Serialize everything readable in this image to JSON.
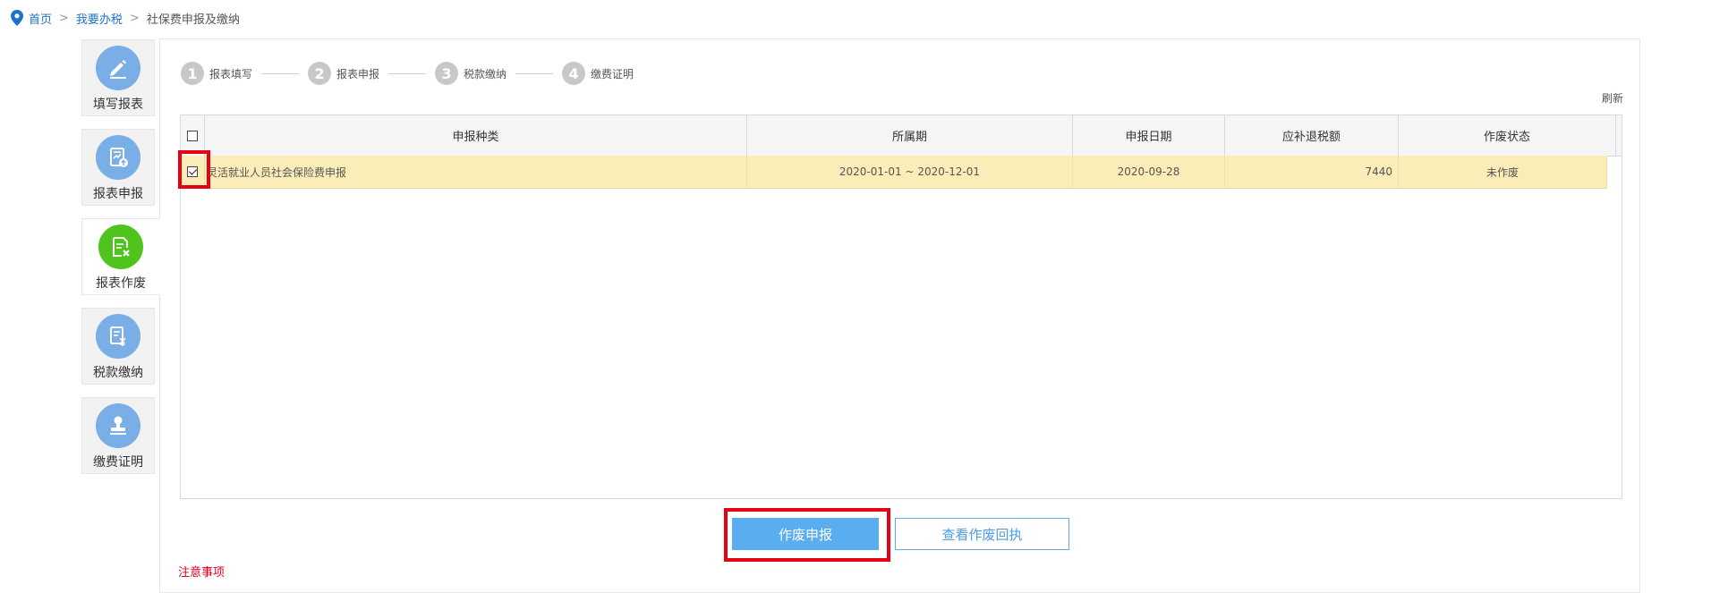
{
  "breadcrumb": {
    "home": "首页",
    "sep": ">",
    "level2": "我要办税",
    "current": "社保费申报及缴纳"
  },
  "nav": {
    "items": [
      {
        "label": "填写报表",
        "icon": "pencil-icon"
      },
      {
        "label": "报表申报",
        "icon": "report-upload-icon"
      },
      {
        "label": "报表作废",
        "icon": "report-void-icon"
      },
      {
        "label": "税款缴纳",
        "icon": "tax-payment-icon"
      },
      {
        "label": "缴费证明",
        "icon": "stamp-icon"
      }
    ],
    "active_index": 2
  },
  "steps": [
    {
      "num": "1",
      "label": "报表填写"
    },
    {
      "num": "2",
      "label": "报表申报"
    },
    {
      "num": "3",
      "label": "税款缴纳"
    },
    {
      "num": "4",
      "label": "缴费证明"
    }
  ],
  "refresh_label": "刷新",
  "table": {
    "headers": [
      "申报种类",
      "所属期",
      "申报日期",
      "应补退税额",
      "作废状态"
    ],
    "rows": [
      {
        "checked": true,
        "type": "灵活就业人员社会保险费申报",
        "period": "2020-01-01 ~ 2020-12-01",
        "date": "2020-09-28",
        "amount": "7440",
        "status": "未作废"
      }
    ]
  },
  "buttons": {
    "void": "作废申报",
    "view_receipt": "查看作废回执"
  },
  "notice": "注意事项",
  "colors": {
    "highlight": "#e60012",
    "primary": "#5aaef0",
    "nav_icon": "#7aaee6",
    "nav_active_icon": "#4fc41c",
    "row_selected": "#fbedb7",
    "notice": "#d9001b"
  }
}
